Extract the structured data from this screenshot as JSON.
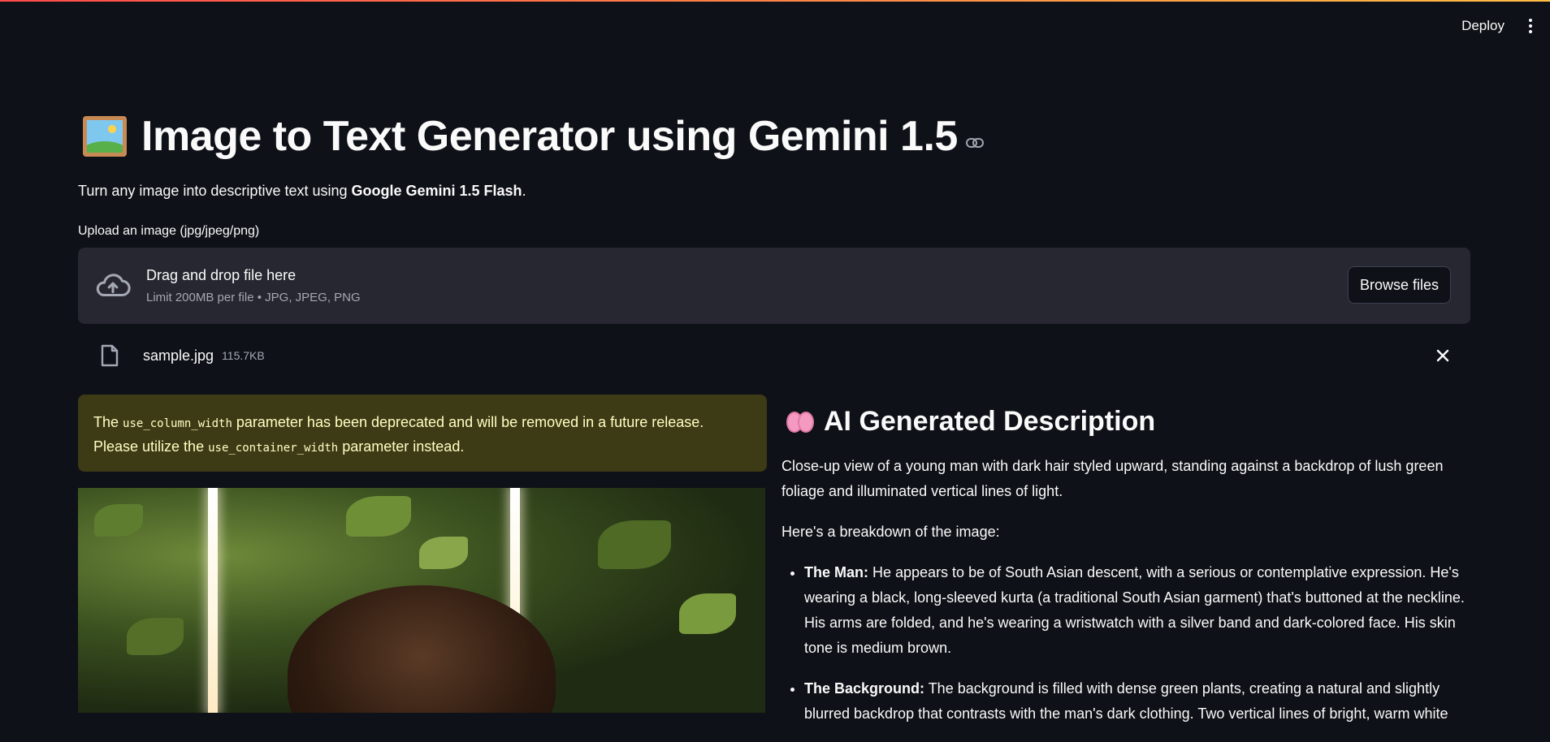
{
  "header": {
    "deploy_label": "Deploy",
    "menu_icon": "kebab-menu-icon"
  },
  "page": {
    "title": "Image to Text Generator using Gemini 1.5",
    "subtitle_prefix": "Turn any image into descriptive text using ",
    "subtitle_bold": "Google Gemini 1.5 Flash",
    "subtitle_suffix": "."
  },
  "uploader": {
    "label": "Upload an image (jpg/jpeg/png)",
    "drop_title": "Drag and drop file here",
    "drop_limit": "Limit 200MB per file • JPG, JPEG, PNG",
    "browse_label": "Browse files",
    "file": {
      "name": "sample.jpg",
      "size": "115.7KB"
    }
  },
  "warning": {
    "part1": "The ",
    "code1": "use_column_width",
    "part2": " parameter has been deprecated and will be removed in a future release. Please utilize the ",
    "code2": "use_container_width",
    "part3": " parameter instead."
  },
  "description": {
    "heading": "AI Generated Description",
    "intro": "Close-up view of a young man with dark hair styled upward, standing against a backdrop of lush green foliage and illuminated vertical lines of light.",
    "breakdown_intro": "Here's a breakdown of the image:",
    "items": [
      {
        "label": "The Man:",
        "text": " He appears to be of South Asian descent, with a serious or contemplative expression. He's wearing a black, long-sleeved kurta (a traditional South Asian garment) that's buttoned at the neckline. His arms are folded, and he's wearing a wristwatch with a silver band and dark-colored face. His skin tone is medium brown."
      },
      {
        "label": "The Background:",
        "text": " The background is filled with dense green plants, creating a natural and slightly blurred backdrop that contrasts with the man's dark clothing. Two vertical lines of bright, warm white"
      }
    ]
  }
}
